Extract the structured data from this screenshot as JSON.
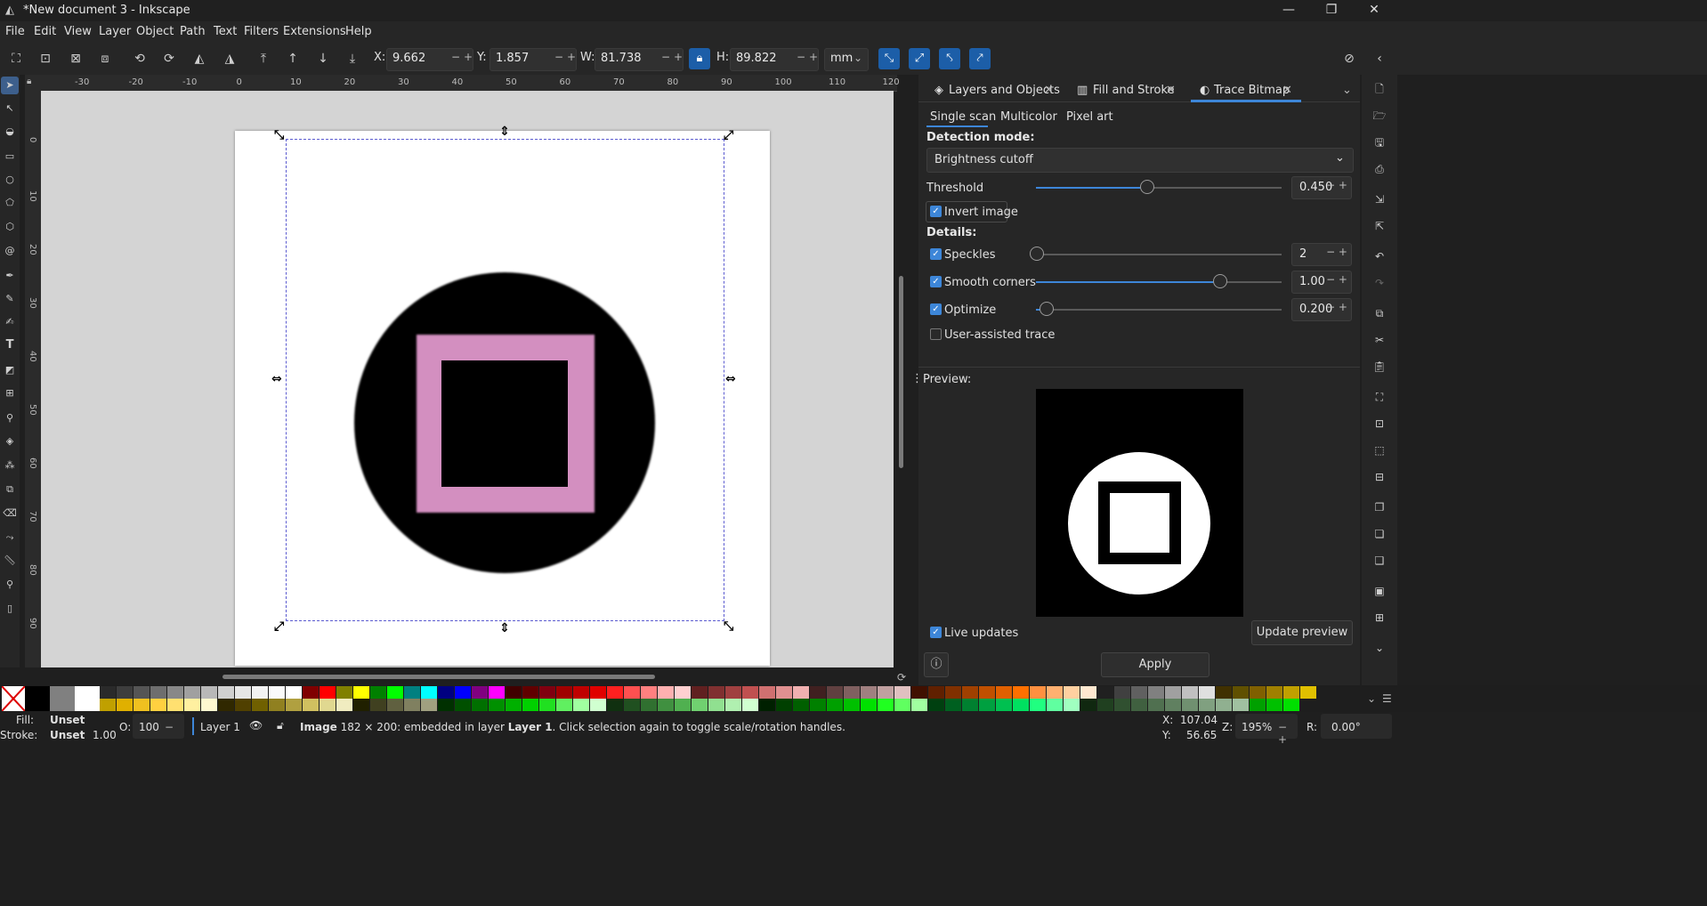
{
  "window": {
    "title": "*New document 3 - Inkscape"
  },
  "menu": [
    "File",
    "Edit",
    "View",
    "Layer",
    "Object",
    "Path",
    "Text",
    "Filters",
    "Extensions",
    "Help"
  ],
  "toolbar": {
    "x_label": "X:",
    "x_value": "9.662",
    "y_label": "Y:",
    "y_value": "1.857",
    "w_label": "W:",
    "w_value": "81.738",
    "h_label": "H:",
    "h_value": "89.822",
    "unit": "mm"
  },
  "ruler": {
    "h_ticks": [
      "-30",
      "-20",
      "-10",
      "0",
      "10",
      "20",
      "30",
      "40",
      "50",
      "60",
      "70",
      "80",
      "90",
      "100",
      "110",
      "120"
    ],
    "v_ticks": [
      "0",
      "10",
      "20",
      "30",
      "40",
      "50",
      "60",
      "70",
      "80",
      "90"
    ]
  },
  "dialog": {
    "tabs": [
      {
        "label": "Layers and Objects"
      },
      {
        "label": "Fill and Stroke"
      },
      {
        "label": "Trace Bitmap"
      }
    ],
    "subtabs": [
      "Single scan",
      "Multicolor",
      "Pixel art"
    ],
    "detection_mode_label": "Detection mode:",
    "detection_mode_value": "Brightness cutoff",
    "threshold_label": "Threshold",
    "threshold_value": "0.450",
    "threshold_fraction": 0.45,
    "invert_label": "Invert image",
    "details_label": "Details:",
    "speckles_label": "Speckles",
    "speckles_value": "2",
    "smooth_label": "Smooth corners",
    "smooth_value": "1.00",
    "optimize_label": "Optimize",
    "optimize_value": "0.200",
    "user_assisted_label": "User-assisted trace",
    "preview_label": "Preview:",
    "live_updates_label": "Live updates",
    "update_preview_label": "Update preview",
    "apply_label": "Apply"
  },
  "status": {
    "fill_label": "Fill:",
    "fill_value": "Unset",
    "stroke_label": "Stroke:",
    "stroke_value": "Unset",
    "stroke_width": "1.00",
    "opacity_label": "O:",
    "opacity_value": "100",
    "layer": "Layer 1",
    "message_bold": "Image",
    "message_rest": " 182 × 200: embedded in layer ",
    "message_layer": "Layer 1",
    "message_tail": ". Click selection again to toggle scale/rotation handles.",
    "cursor_x_label": "X:",
    "cursor_x": "107.04",
    "cursor_y_label": "Y:",
    "cursor_y": "56.65",
    "zoom_label": "Z:",
    "zoom": "195%",
    "rotation_label": "R:",
    "rotation": "0.00°"
  }
}
